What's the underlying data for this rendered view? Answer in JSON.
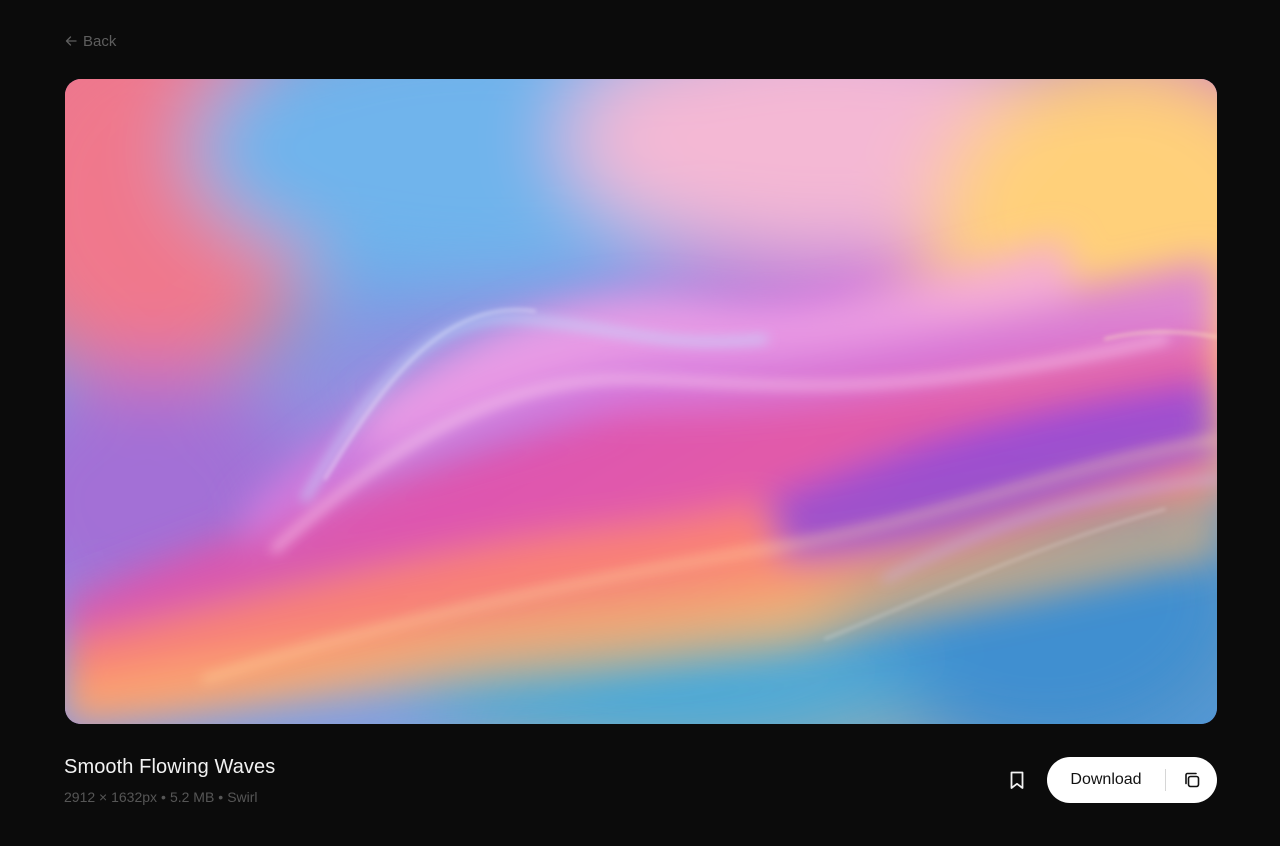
{
  "nav": {
    "back_label": "Back",
    "back_icon": "arrow-left-icon"
  },
  "image": {
    "alt": "Smooth Flowing Waves",
    "palette": [
      "#5a8fe0",
      "#e06ac8",
      "#ff6fa0",
      "#ffb36a",
      "#9b5cf0",
      "#56c7e8"
    ]
  },
  "details": {
    "title": "Smooth Flowing Waves",
    "dimensions": "2912 × 1632px",
    "separator": "•",
    "file_size": "5.2 MB",
    "category": "Swirl"
  },
  "actions": {
    "bookmark_icon": "bookmark-icon",
    "download_label": "Download",
    "copy_icon": "copy-icon"
  }
}
